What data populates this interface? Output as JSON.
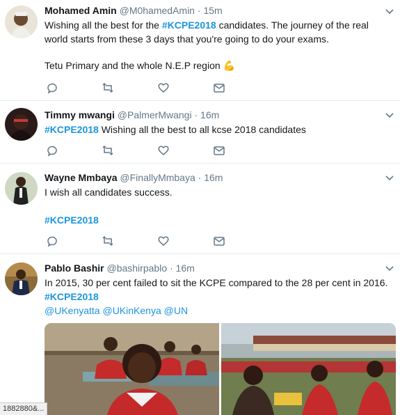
{
  "tweets": [
    {
      "name": "Mohamed Amin",
      "handle": "@M0hamedAmin",
      "sep": "·",
      "time": "15m",
      "text_pre": "Wishing all the best for the ",
      "tag": "#KCPE2018",
      "text_post": " candidates. The journey of the real world starts from these 3 days that you're going to do your exams.",
      "line2": "Tetu Primary and the whole N.E.P region",
      "emoji": "💪"
    },
    {
      "name": "Timmy mwangi",
      "handle": "@PalmerMwangi",
      "sep": "·",
      "time": "16m",
      "tag": "#KCPE2018",
      "text_post": " Wishing all the best to all kcse 2018 candidates"
    },
    {
      "name": "Wayne Mmbaya",
      "handle": "@FinallyMmbaya",
      "sep": "·",
      "time": "16m",
      "text": "I wish all candidates success.",
      "tag": "#KCPE2018"
    },
    {
      "name": "Pablo Bashir",
      "handle": "@bashirpablo",
      "sep": "·",
      "time": "16m",
      "text": "In 2015, 30 per cent failed to sit the KCPE compared to the 28 per cent in 2016.",
      "tag": "#KCPE2018",
      "mentions": [
        "@UKenyatta",
        "@UKinKenya",
        "@UN"
      ]
    }
  ],
  "status_url": "1882880&...",
  "colors": {
    "link": "#1b95e0",
    "muted": "#657786",
    "divider": "#e6ecf0"
  },
  "icons": [
    "reply-icon",
    "retweet-icon",
    "like-icon",
    "dm-icon",
    "chevron-down-icon"
  ]
}
